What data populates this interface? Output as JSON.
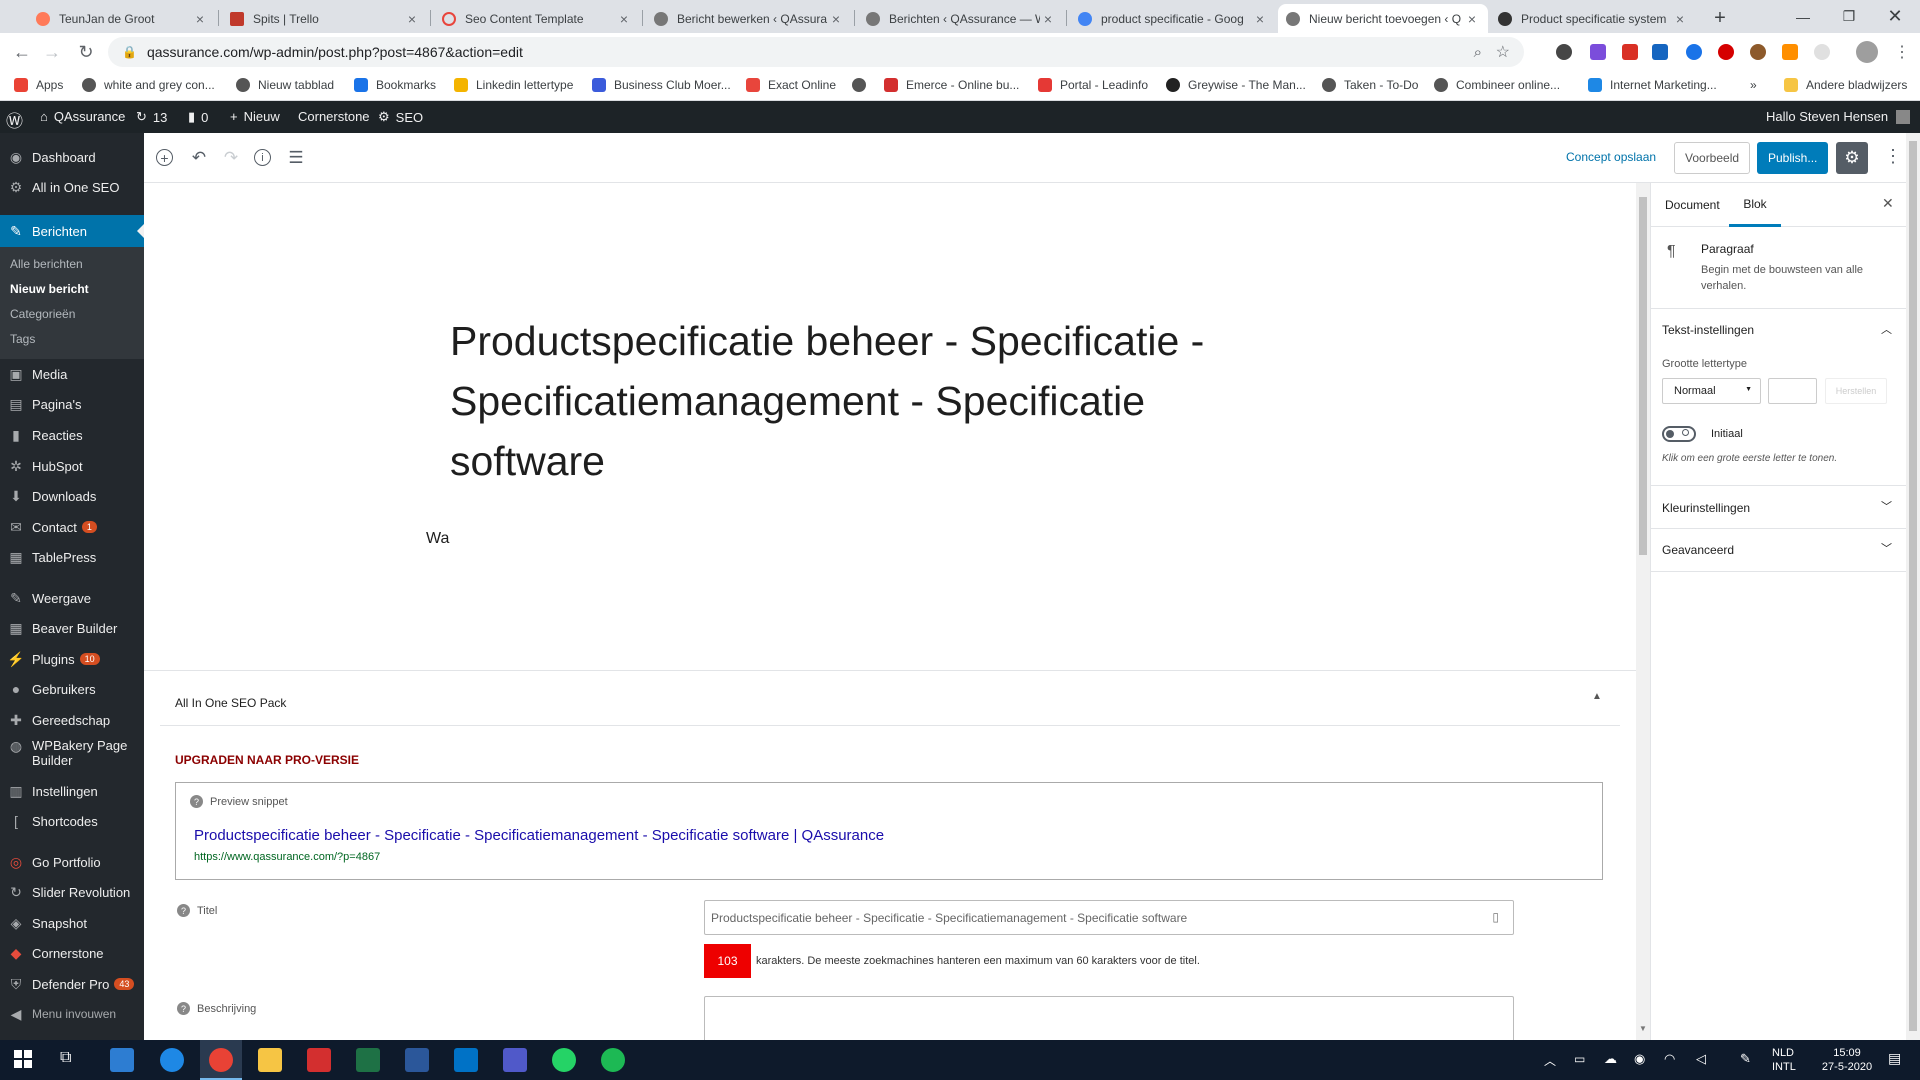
{
  "browser": {
    "tabs": [
      {
        "title": "TeunJan de Groot",
        "color": "#ff7a59"
      },
      {
        "title": "Spits | Trello",
        "color": "#c0392b"
      },
      {
        "title": "Seo Content Template",
        "color": "#e8453c"
      },
      {
        "title": "Bericht bewerken ‹ QAssura",
        "color": "#555"
      },
      {
        "title": "Berichten ‹ QAssurance — W",
        "color": "#555"
      },
      {
        "title": "product specificatie - Goog",
        "color": "#4285f4"
      },
      {
        "title": "Nieuw bericht toevoegen ‹ Q",
        "color": "#555"
      },
      {
        "title": "Product specificatie system",
        "color": "#333"
      }
    ],
    "new_tab": "+",
    "url": "qassurance.com/wp-admin/post.php?post=4867&action=edit",
    "bookmarks": [
      {
        "label": "Apps",
        "color": "#ea4335"
      },
      {
        "label": "white and grey con...",
        "color": "#555"
      },
      {
        "label": "Nieuw tabblad",
        "color": "#555"
      },
      {
        "label": "Bookmarks",
        "color": "#1a73e8"
      },
      {
        "label": "Linkedin lettertype",
        "color": "#f4b400"
      },
      {
        "label": "Business Club Moer...",
        "color": "#3b5bdb"
      },
      {
        "label": "Exact Online",
        "color": "#e8453c"
      },
      {
        "label": "",
        "color": "#555"
      },
      {
        "label": "Emerce - Online bu...",
        "color": "#d32f2f"
      },
      {
        "label": "Portal - Leadinfo",
        "color": "#e53935"
      },
      {
        "label": "Greywise - The Man...",
        "color": "#222"
      },
      {
        "label": "Taken - To-Do",
        "color": "#555"
      },
      {
        "label": "Combineer online...",
        "color": "#555"
      },
      {
        "label": "Internet Marketing...",
        "color": "#1e88e5"
      }
    ],
    "bookmarks_more": "»",
    "other_bookmarks": "Andere bladwijzers"
  },
  "adminbar": {
    "site": "QAssurance",
    "updates": "13",
    "comments": "0",
    "new": "Nieuw",
    "cornerstone": "Cornerstone",
    "seo": "SEO",
    "greeting": "Hallo Steven Hensen"
  },
  "sidebar": {
    "items": [
      {
        "label": "Dashboard",
        "icon": "dashboard-icon",
        "glyph": "◉",
        "top": 0
      },
      {
        "label": "All in One SEO",
        "icon": "gear-icon",
        "glyph": "⚙",
        "top": 1
      }
    ],
    "berichten": "Berichten",
    "sub": [
      "Alle berichten",
      "Nieuw bericht",
      "Categorieën",
      "Tags"
    ],
    "menu": [
      {
        "label": "Media",
        "icon": "media-icon",
        "glyph": "▣"
      },
      {
        "label": "Pagina's",
        "icon": "page-icon",
        "glyph": "▤"
      },
      {
        "label": "Reacties",
        "icon": "comment-icon",
        "glyph": "▮"
      },
      {
        "label": "HubSpot",
        "icon": "hubspot-icon",
        "glyph": "✲"
      },
      {
        "label": "Downloads",
        "icon": "download-icon",
        "glyph": "⬇"
      },
      {
        "label": "Contact",
        "icon": "mail-icon",
        "glyph": "✉",
        "badge": "1"
      },
      {
        "label": "TablePress",
        "icon": "table-icon",
        "glyph": "▦"
      },
      {
        "label": "Weergave",
        "icon": "brush-icon",
        "glyph": "✎"
      },
      {
        "label": "Beaver Builder",
        "icon": "grid-icon",
        "glyph": "▦"
      },
      {
        "label": "Plugins",
        "icon": "plugin-icon",
        "glyph": "⚡",
        "badge": "10"
      },
      {
        "label": "Gebruikers",
        "icon": "user-icon",
        "glyph": "●"
      },
      {
        "label": "Gereedschap",
        "icon": "wrench-icon",
        "glyph": "✚"
      },
      {
        "label": "WPBakery Page Builder",
        "icon": "bakery-icon",
        "glyph": "◍"
      },
      {
        "label": "Instellingen",
        "icon": "settings-icon",
        "glyph": "▥"
      },
      {
        "label": "Shortcodes",
        "icon": "bracket-icon",
        "glyph": "["
      },
      {
        "label": "Go Portfolio",
        "icon": "portfolio-icon",
        "glyph": "◎"
      },
      {
        "label": "Slider Revolution",
        "icon": "refresh-icon",
        "glyph": "↻"
      },
      {
        "label": "Snapshot",
        "icon": "snapshot-icon",
        "glyph": "◈"
      },
      {
        "label": "Cornerstone",
        "icon": "cornerstone-icon",
        "glyph": "◆"
      },
      {
        "label": "Defender Pro",
        "icon": "shield-icon",
        "glyph": "⛨",
        "badge": "43"
      },
      {
        "label": "Menu invouwen",
        "icon": "collapse-icon",
        "glyph": "◀"
      }
    ]
  },
  "editor": {
    "save_draft": "Concept opslaan",
    "preview": "Voorbeeld",
    "publish": "Publish...",
    "title": "Productspecificatie beheer  - Specificatie - Specificatiemanagement - Specificatie software",
    "paragraph": "Wa"
  },
  "seo": {
    "panel_title": "All In One SEO Pack",
    "upgrade": "UPGRADEN NAAR PRO-VERSIE",
    "preview_label": "Preview snippet",
    "snippet_title": "Productspecificatie beheer - Specificatie - Specificatiemanagement - Specificatie software | QAssurance",
    "snippet_url": "https://www.qassurance.com/?p=4867",
    "title_label": "Titel",
    "title_value": "Productspecificatie beheer  - Specificatie - Specificatiemanagement - Specificatie software",
    "char_count": "103",
    "char_note": "karakters. De meeste zoekmachines hanteren een maximum van 60 karakters voor de titel.",
    "desc_label": "Beschrijving"
  },
  "settings": {
    "tab_document": "Document",
    "tab_block": "Blok",
    "block_name": "Paragraaf",
    "block_desc": "Begin met de bouwsteen van alle verhalen.",
    "text_settings": "Tekst-instellingen",
    "font_size_label": "Grootte lettertype",
    "font_size_value": "Normaal",
    "reset": "Herstellen",
    "dropcap_label": "Initiaal",
    "dropcap_help": "Klik om een grote eerste letter te tonen.",
    "color_settings": "Kleurinstellingen",
    "advanced": "Geavanceerd"
  },
  "taskbar": {
    "lang1": "NLD",
    "lang2": "INTL",
    "time": "15:09",
    "date": "27-5-2020"
  },
  "colors": {
    "wp_blue": "#0073aa",
    "publish": "#007cba",
    "red": "#e00",
    "upgrade": "#8b0000"
  }
}
